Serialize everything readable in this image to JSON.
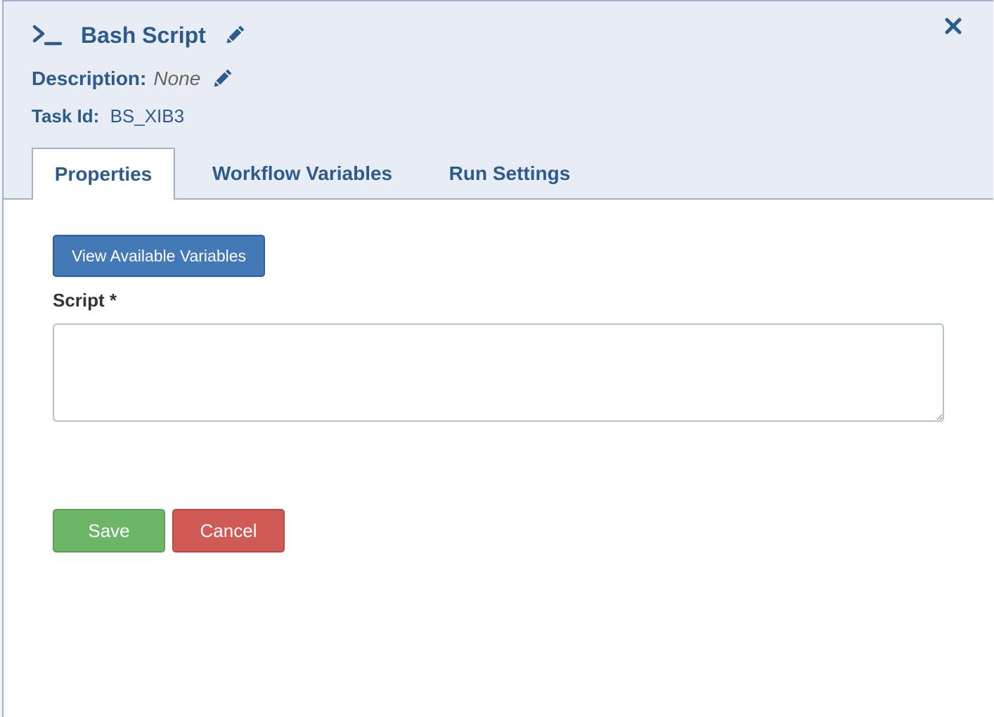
{
  "header": {
    "title": "Bash Script",
    "description_label": "Description:",
    "description_value": "None",
    "task_id_label": "Task Id:",
    "task_id_value": "BS_XIB3",
    "icons": {
      "type": "terminal-icon",
      "edit_title": "pencil-icon",
      "edit_description": "pencil-icon",
      "close": "close-icon"
    }
  },
  "tabs": [
    {
      "label": "Properties",
      "active": true
    },
    {
      "label": "Workflow Variables",
      "active": false
    },
    {
      "label": "Run Settings",
      "active": false
    }
  ],
  "properties": {
    "view_variables_label": "View Available Variables",
    "script_label": "Script *",
    "script_value": ""
  },
  "actions": {
    "save_label": "Save",
    "cancel_label": "Cancel"
  },
  "colors": {
    "accent": "#2d5b8c",
    "header_bg": "#e8edf5",
    "primary_button": "#4479b7",
    "save_button": "#6db567",
    "cancel_button": "#d05a55"
  }
}
